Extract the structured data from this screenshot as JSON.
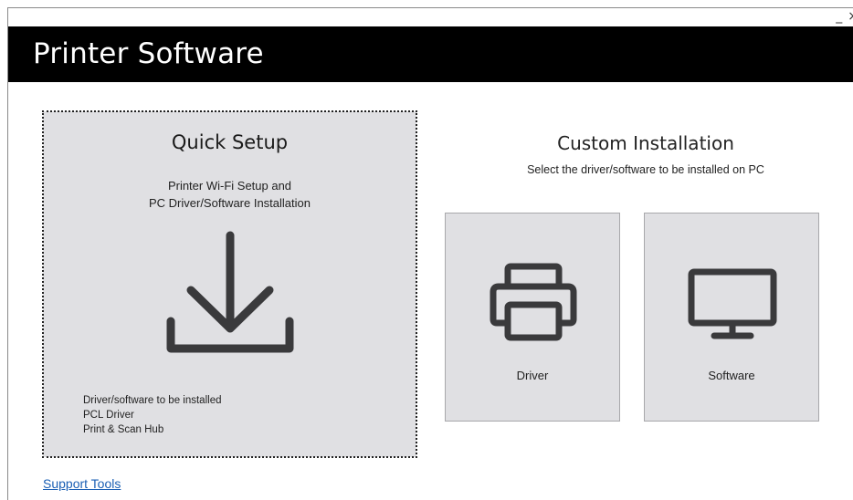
{
  "window": {
    "minimize_glyph": "_",
    "close_glyph": "×"
  },
  "header": {
    "title": "Printer Software"
  },
  "quick_setup": {
    "title": "Quick Setup",
    "description_line1": "Printer Wi-Fi Setup and",
    "description_line2": "PC Driver/Software Installation",
    "icon": "download-icon",
    "installed_heading": "Driver/software to be installed",
    "installed_items": [
      "PCL Driver",
      "Print & Scan Hub"
    ]
  },
  "custom_installation": {
    "title": "Custom Installation",
    "subtitle": "Select the driver/software to be installed on PC",
    "tiles": [
      {
        "label": "Driver",
        "icon": "printer-icon"
      },
      {
        "label": "Software",
        "icon": "monitor-icon"
      }
    ]
  },
  "footer": {
    "support_link": "Support Tools"
  },
  "colors": {
    "header_bg": "#000000",
    "tile_bg": "#e0e0e3",
    "icon_color": "#3a3a3c",
    "link": "#1a5fb4"
  }
}
